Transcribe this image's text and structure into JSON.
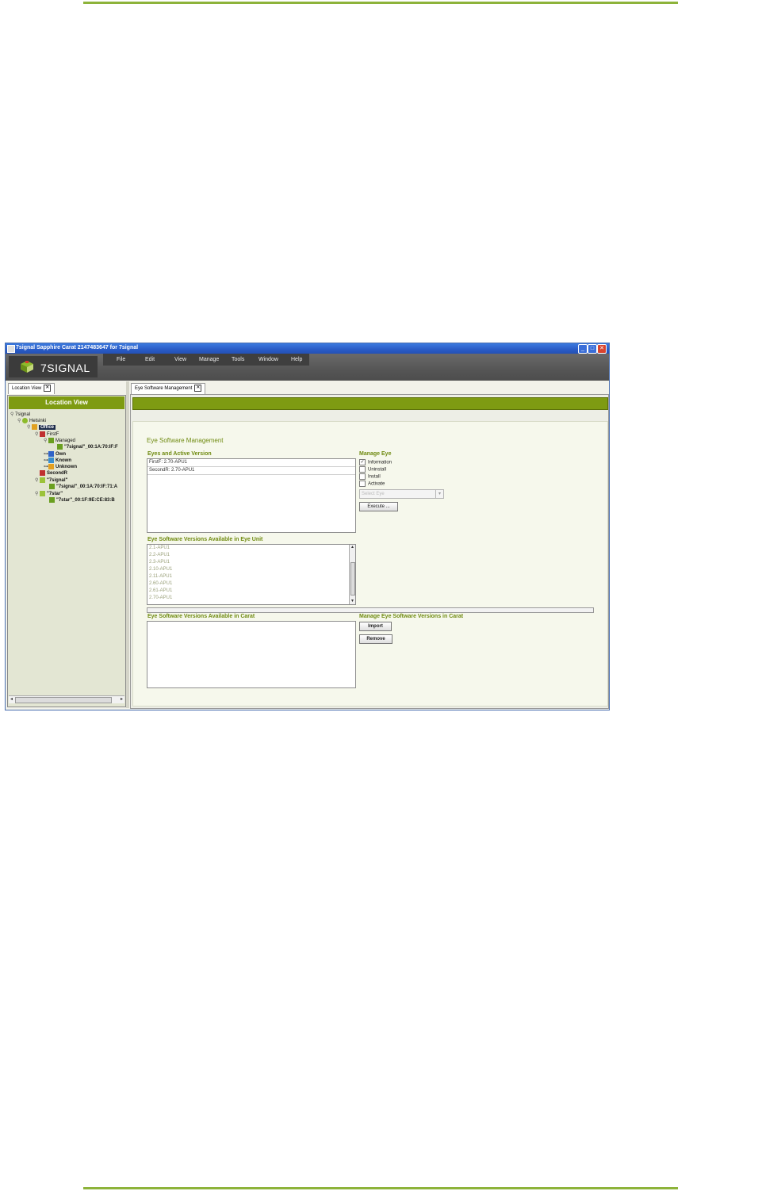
{
  "window": {
    "title": "7signal Sapphire Carat  2147483647 for 7signal",
    "minimize": "_",
    "maximize": "□",
    "close": "✕"
  },
  "logo": {
    "text": "7SIGNAL"
  },
  "menu": [
    "File",
    "Edit",
    "View",
    "Manage",
    "Tools",
    "Window",
    "Help"
  ],
  "left_panel": {
    "tab_label": "Location View",
    "header": "Location View",
    "tree": [
      {
        "label": "7signal",
        "level": 0,
        "icon": "root"
      },
      {
        "label": "Helsinki",
        "level": 1,
        "icon": "city"
      },
      {
        "label": "Office",
        "level": 2,
        "icon": "building",
        "selected": true
      },
      {
        "label": "FirstF",
        "level": 3,
        "icon": "floor"
      },
      {
        "label": "Managed",
        "level": 4,
        "icon": "eye-group"
      },
      {
        "label": "\"7signal\"_00:1A:70:IF:F",
        "level": 5,
        "icon": "eye"
      },
      {
        "label": "Own",
        "level": 4,
        "icon": "own"
      },
      {
        "label": "Known",
        "level": 4,
        "icon": "known"
      },
      {
        "label": "Unknown",
        "level": 4,
        "icon": "unknown"
      },
      {
        "label": "SecondR",
        "level": 3,
        "icon": "floor"
      },
      {
        "label": "\"7signal\"",
        "level": 3,
        "icon": "ssid"
      },
      {
        "label": "\"7signal\"_00:1A:70:IF:71:A",
        "level": 4,
        "icon": "eye"
      },
      {
        "label": "\"7star\"",
        "level": 3,
        "icon": "ssid"
      },
      {
        "label": "\"7star\"_00:1F:9E:CE:83:B",
        "level": 4,
        "icon": "eye"
      }
    ]
  },
  "main": {
    "tab_label": "Eye Software Management",
    "title": "Eye Software Management",
    "eyes_section": {
      "label": "Eyes and Active Version",
      "rows": [
        "FirstF: 2.70-APU1",
        "SecondR: 2.70-APU1"
      ]
    },
    "manage_eye": {
      "label": "Manage Eye",
      "options": [
        {
          "label": "Information",
          "checked": true
        },
        {
          "label": "Uninstall",
          "checked": false
        },
        {
          "label": "Install",
          "checked": false
        },
        {
          "label": "Activate",
          "checked": false
        }
      ],
      "select_value": "Select Eye",
      "execute_label": "Execute ..."
    },
    "unit_section": {
      "label": "Eye Software Versions Available in Eye Unit",
      "rows": [
        "2.1-APU1",
        "2.2-APU1",
        "2.3-APU1",
        "2.10-APU1",
        "2.11-APU1",
        "2.60-APU1",
        "2.61-APU1",
        "2.70-APU1"
      ]
    },
    "carat_section": {
      "label": "Eye Software Versions Available in Carat"
    },
    "manage_carat": {
      "label": "Manage Eye Software Versions in Carat",
      "import_label": "Import",
      "remove_label": "Remove"
    }
  },
  "colors": {
    "accent": "#7e9b12",
    "title_green": "#6f8a10",
    "rule": "#8db33a"
  }
}
